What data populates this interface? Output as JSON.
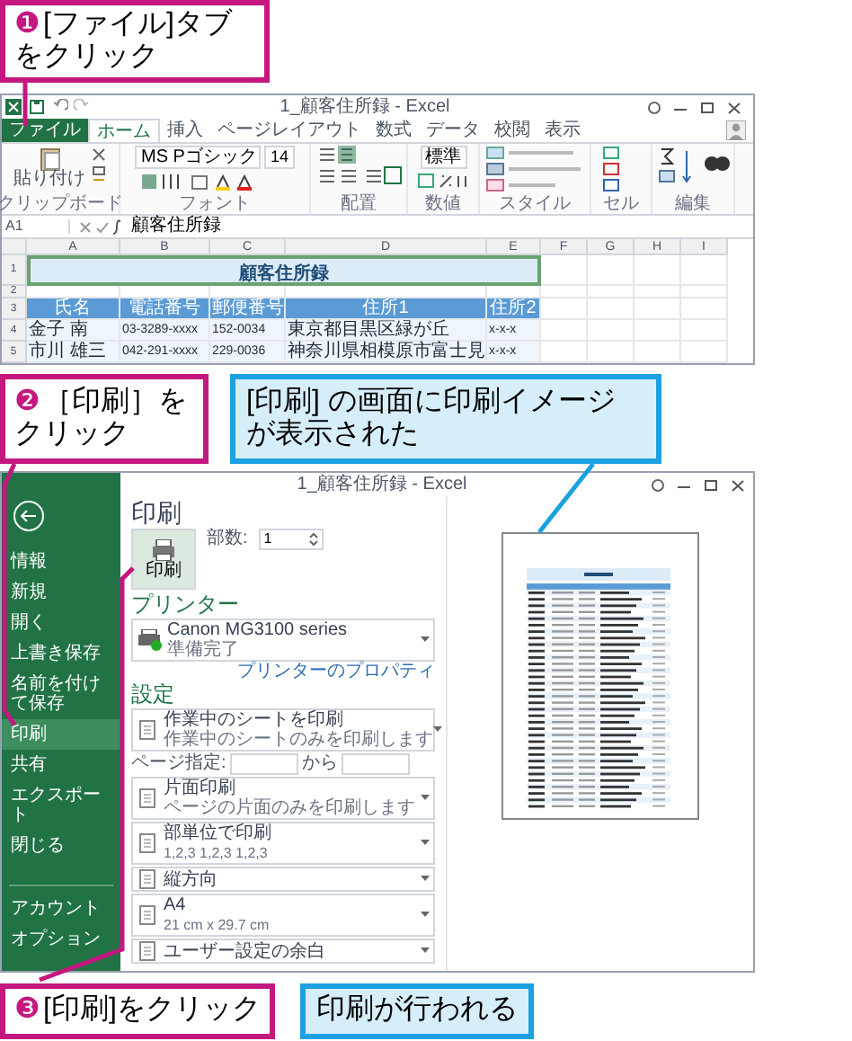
{
  "step1": {
    "marker": "❶",
    "lines": [
      "[ファイル]タブ",
      "をクリック"
    ]
  },
  "window1": {
    "title": "1_顧客住所録 - Excel",
    "tabs": [
      {
        "label": "ファイル",
        "kind": "file",
        "selected": false
      },
      {
        "label": "ホーム",
        "kind": "tab",
        "selected": true
      },
      {
        "label": "挿入",
        "kind": "tab",
        "selected": false
      },
      {
        "label": "ページレイアウト",
        "kind": "tab",
        "selected": false
      },
      {
        "label": "数式",
        "kind": "tab",
        "selected": false
      },
      {
        "label": "データ",
        "kind": "tab",
        "selected": false
      },
      {
        "label": "校閲",
        "kind": "tab",
        "selected": false
      },
      {
        "label": "表示",
        "kind": "tab",
        "selected": false
      }
    ],
    "paste_label": "貼り付け",
    "font_name": "MS Pゴシック",
    "font_size": "14",
    "number_format": "標準",
    "groups": [
      "クリップボード",
      "フォント",
      "配置",
      "数値",
      "スタイル",
      "セル",
      "編集"
    ],
    "name_box": "A1",
    "formula": "顧客住所録",
    "columns": [
      "A",
      "B",
      "C",
      "D",
      "E",
      "F",
      "G",
      "H",
      "I"
    ],
    "rows": [
      {
        "number": "1",
        "kind": "title",
        "cells": [
          "顧客住所録"
        ]
      },
      {
        "number": "2",
        "kind": "empty",
        "cells": []
      },
      {
        "number": "3",
        "kind": "header",
        "cells": [
          "氏名",
          "電話番号",
          "郵便番号",
          "住所1",
          "住所2"
        ]
      },
      {
        "number": "4",
        "kind": "data",
        "cells": [
          "金子 南",
          "03-3289-xxxx",
          "152-0034",
          "東京都目黒区緑が丘",
          "x-x-x"
        ]
      },
      {
        "number": "5",
        "kind": "data",
        "cells": [
          "市川 雄三",
          "042-291-xxxx",
          "229-0036",
          "神奈川県相模原市富士見",
          "x-x-x"
        ]
      }
    ]
  },
  "step2": {
    "marker": "❷",
    "lines": [
      "［印刷］を",
      "クリック"
    ]
  },
  "note1": {
    "lines": [
      "[印刷] の画面に印刷イメージ",
      "が表示された"
    ]
  },
  "window2": {
    "title": "1_顧客住所録 - Excel",
    "sidebar": [
      {
        "label": "情報",
        "selected": false
      },
      {
        "label": "新規",
        "selected": false
      },
      {
        "label": "開く",
        "selected": false
      },
      {
        "label": "上書き保存",
        "selected": false
      },
      {
        "label": "名前を付けて保存",
        "selected": false
      },
      {
        "label": "印刷",
        "selected": true
      },
      {
        "label": "共有",
        "selected": false
      },
      {
        "label": "エクスポート",
        "selected": false
      },
      {
        "label": "閉じる",
        "selected": false
      },
      {
        "label": "アカウント",
        "selected": false
      },
      {
        "label": "オプション",
        "selected": false
      }
    ],
    "heading": "印刷",
    "print_button": "印刷",
    "copies_label": "部数:",
    "copies_value": "1",
    "printer_heading": "プリンター",
    "printer_name": "Canon MG3100 series",
    "printer_status": "準備完了",
    "printer_link": "プリンターのプロパティ",
    "settings_heading": "設定",
    "settings": [
      {
        "kind": "dropdown",
        "title": "作業中のシートを印刷",
        "subtitle": "作業中のシートのみを印刷します"
      },
      {
        "kind": "range",
        "label": "ページ指定:",
        "to_label": "から"
      },
      {
        "kind": "dropdown",
        "title": "片面印刷",
        "subtitle": "ページの片面のみを印刷します"
      },
      {
        "kind": "dropdown",
        "title": "部単位で印刷",
        "subtitle": "1,2,3 1,2,3 1,2,3"
      },
      {
        "kind": "dropdown",
        "title": "縦方向"
      },
      {
        "kind": "dropdown",
        "title": "A4",
        "subtitle": "21 cm x 29.7 cm"
      },
      {
        "kind": "dropdown",
        "title": "ユーザー設定の余白"
      }
    ]
  },
  "step3": {
    "marker": "❸",
    "lines": [
      "[印刷]をクリック"
    ]
  },
  "note2": {
    "lines": [
      "印刷が行われる"
    ]
  }
}
